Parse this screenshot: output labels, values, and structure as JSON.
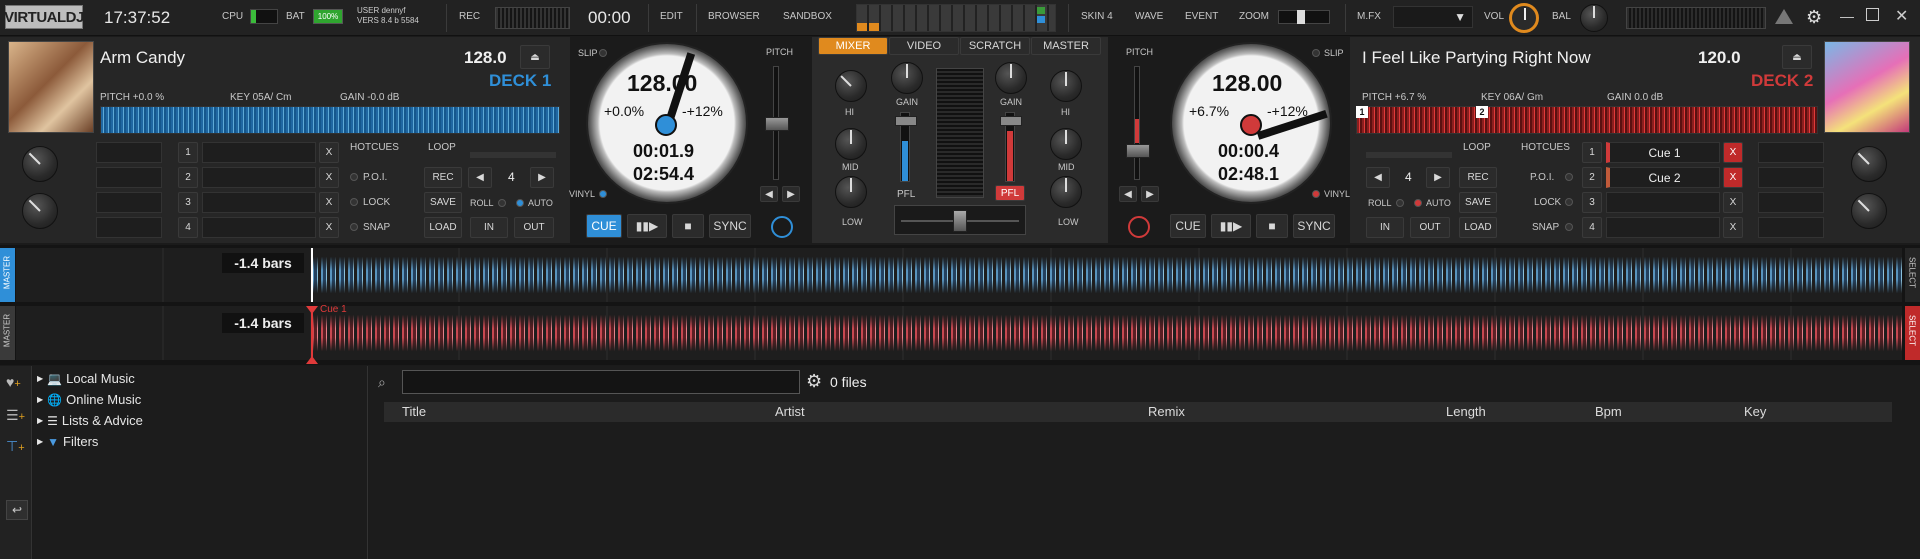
{
  "app": {
    "logo": "VIRTUALDJ",
    "clock": "17:37:52",
    "cpu_label": "CPU",
    "bat_label": "BAT",
    "bat_value": "100%",
    "user_label": "USER",
    "user_name": "dennyf",
    "vers_label": "VERS",
    "vers_value": "8.4 b 5584",
    "rec_label": "REC",
    "rec_time": "00:00"
  },
  "topnav": {
    "edit": "EDIT",
    "browser": "BROWSER",
    "sandbox": "SANDBOX",
    "skin": "SKIN 4",
    "wave": "WAVE",
    "event": "EVENT",
    "zoom": "ZOOM",
    "mfx": "M.FX",
    "vol": "VOL",
    "bal": "BAL"
  },
  "deck1": {
    "title": "Arm Candy",
    "bpm": "128.0",
    "deck_label": "DECK 1",
    "pitch": "PITCH +0.0 %",
    "key": "KEY 05A/ Cm",
    "gain": "GAIN -0.0 dB",
    "jog_bpm": "128.00",
    "jog_pitch": "+0.0%",
    "jog_range": "-+12%",
    "elapsed": "00:01.9",
    "remain": "02:54.4",
    "slip": "SLIP",
    "vinyl": "VINYL",
    "pitch_label": "PITCH",
    "cue": "CUE",
    "sync": "SYNC",
    "hotcues": "HOTCUES",
    "poi": "P.O.I.",
    "lock": "LOCK",
    "snap": "SNAP",
    "loop": "LOOP",
    "rec": "REC",
    "loop_len": "4",
    "save": "SAVE",
    "load": "LOAD",
    "roll": "ROLL",
    "auto": "AUTO",
    "in": "IN",
    "out": "OUT",
    "cue_nums": [
      "1",
      "2",
      "3",
      "4"
    ],
    "x": "X",
    "accent": "#2f8fd8"
  },
  "deck2": {
    "title": "I Feel Like Partying Right Now",
    "bpm": "120.0",
    "deck_label": "DECK 2",
    "pitch": "PITCH +6.7 %",
    "key": "KEY 06A/ Gm",
    "gain": "GAIN 0.0 dB",
    "jog_bpm": "128.00",
    "jog_pitch": "+6.7%",
    "jog_range": "-+12%",
    "elapsed": "00:00.4",
    "remain": "02:48.1",
    "slip": "SLIP",
    "vinyl": "VINYL",
    "pitch_label": "PITCH",
    "cue": "CUE",
    "sync": "SYNC",
    "hotcues": "HOTCUES",
    "poi": "P.O.I.",
    "lock": "LOCK",
    "snap": "SNAP",
    "loop": "LOOP",
    "rec": "REC",
    "loop_len": "4",
    "save": "SAVE",
    "load": "LOAD",
    "roll": "ROLL",
    "auto": "AUTO",
    "in": "IN",
    "out": "OUT",
    "cue_nums": [
      "1",
      "2",
      "3",
      "4"
    ],
    "cues": [
      "Cue 1",
      "Cue 2"
    ],
    "x": "X",
    "marker1": "1",
    "marker2": "2",
    "accent": "#d03a3a"
  },
  "mixer": {
    "tabs": [
      "MIXER",
      "VIDEO",
      "SCRATCH",
      "MASTER"
    ],
    "gain": "GAIN",
    "hi": "HI",
    "mid": "MID",
    "low": "LOW",
    "pfl": "PFL",
    "accent": "#e08a1e"
  },
  "waveform": {
    "bars1": "-1.4 bars",
    "bars2": "-1.4 bars",
    "cue1": "Cue 1",
    "master": "MASTER",
    "select": "SELECT"
  },
  "browser": {
    "tree": [
      "Local Music",
      "Online Music",
      "Lists & Advice",
      "Filters"
    ],
    "search_placeholder": "",
    "file_count": "0 files",
    "columns": [
      "Title",
      "Artist",
      "Remix",
      "Length",
      "Bpm",
      "Key"
    ]
  }
}
